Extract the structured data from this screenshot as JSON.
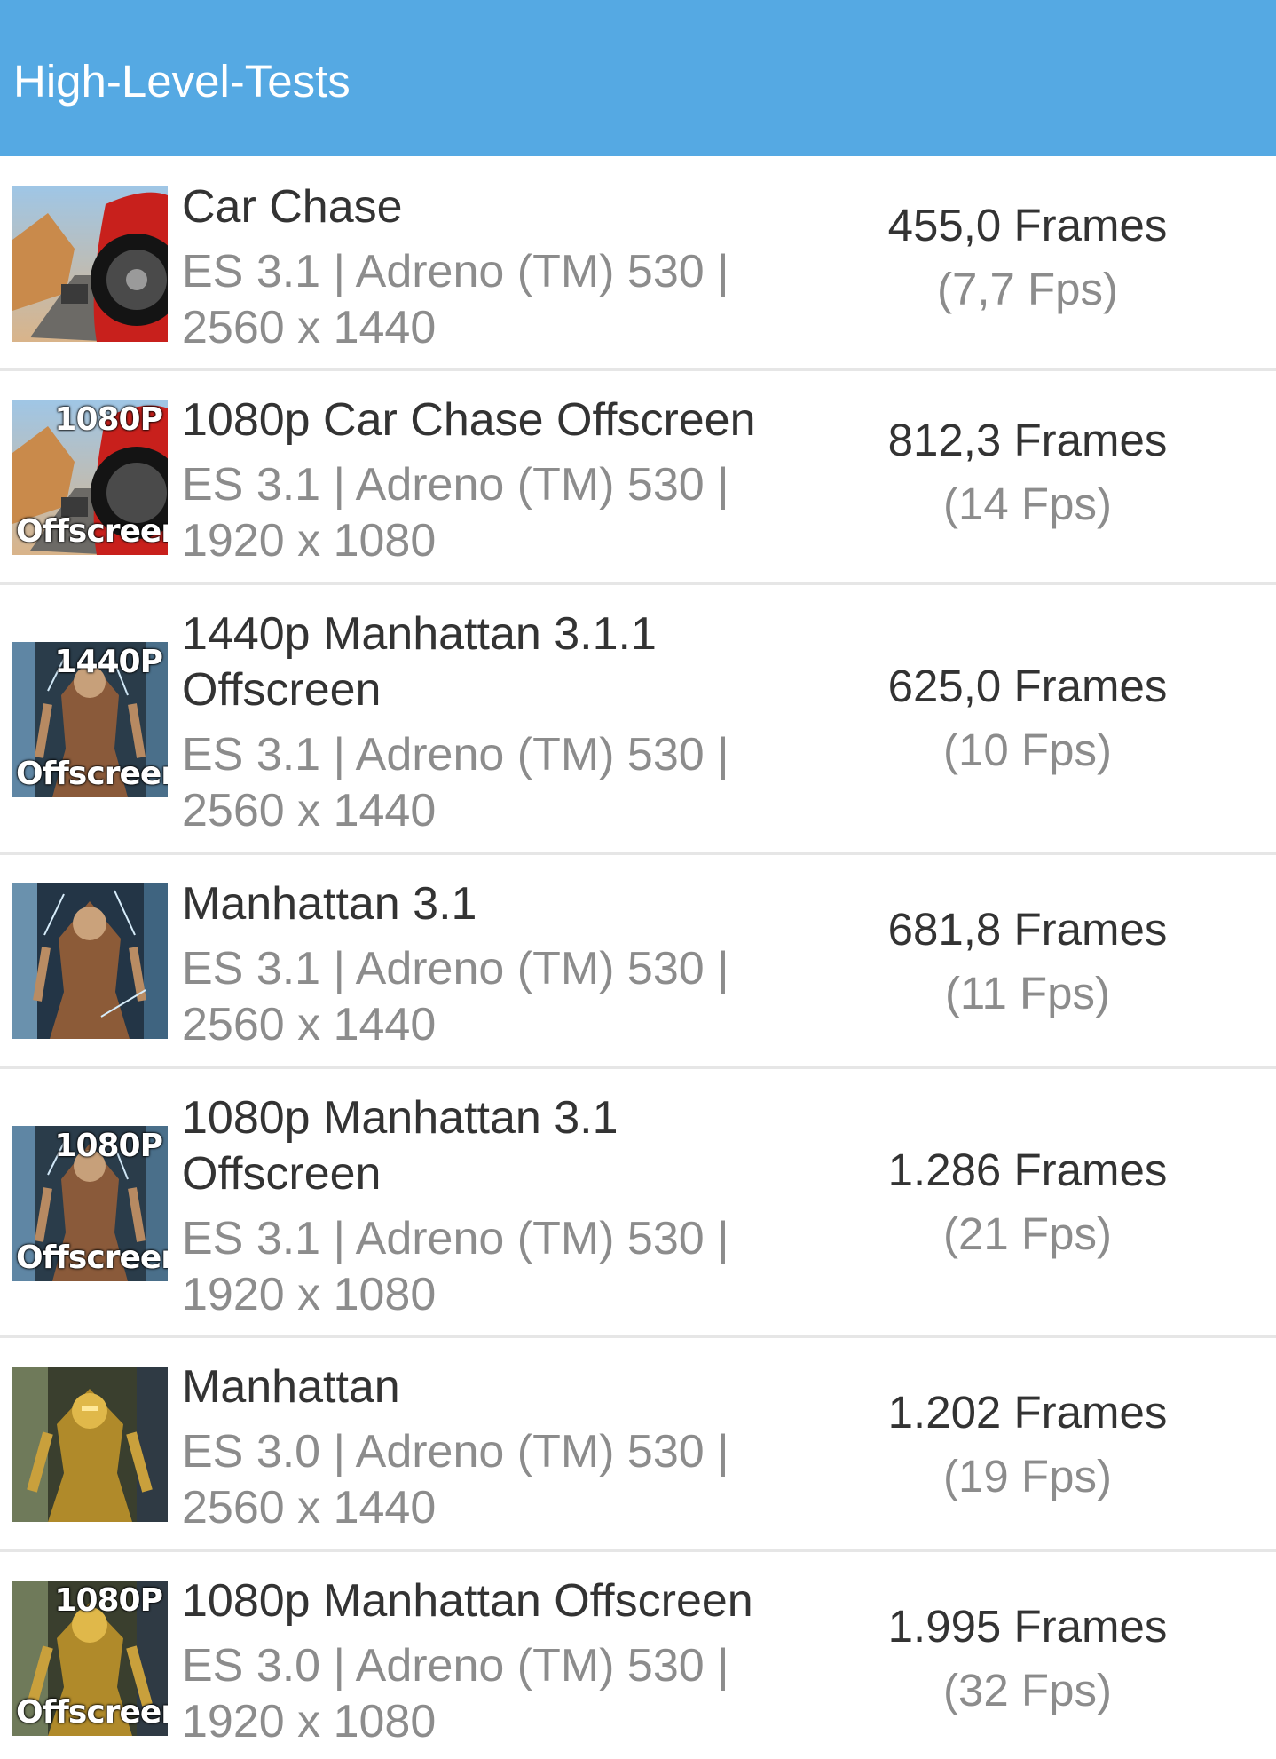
{
  "header": {
    "title": "High-Level-Tests",
    "color": "#55a9e3"
  },
  "tests": [
    {
      "name": "Car Chase",
      "api": "ES 3.1 | Adreno (TM) 530 |",
      "resolution": "2560 x 1440",
      "frames": "455,0 Frames",
      "fps": "(7,7 Fps)",
      "thumb_top": "",
      "thumb_bottom": "",
      "thumb_icon": "car-chase-thumbnail-icon"
    },
    {
      "name": "1080p Car Chase Offscreen",
      "api": "ES 3.1 | Adreno (TM) 530 |",
      "resolution": "1920 x 1080",
      "frames": "812,3 Frames",
      "fps": "(14 Fps)",
      "thumb_top": "1080P",
      "thumb_bottom": "Offscreen",
      "thumb_icon": "car-chase-offscreen-thumbnail-icon"
    },
    {
      "name": "1440p Manhattan 3.1.1 Offscreen",
      "api": "ES 3.1 | Adreno (TM) 530 |",
      "resolution": "2560 x 1440",
      "frames": "625,0 Frames",
      "fps": "(10 Fps)",
      "thumb_top": "1440P",
      "thumb_bottom": "Offscreen",
      "thumb_icon": "manhattan-offscreen-thumbnail-icon"
    },
    {
      "name": "Manhattan 3.1",
      "api": "ES 3.1 | Adreno (TM) 530 |",
      "resolution": "2560 x 1440",
      "frames": "681,8 Frames",
      "fps": "(11 Fps)",
      "thumb_top": "",
      "thumb_bottom": "",
      "thumb_icon": "manhattan-thumbnail-icon"
    },
    {
      "name": "1080p Manhattan 3.1 Offscreen",
      "api": "ES 3.1 | Adreno (TM) 530 |",
      "resolution": "1920 x 1080",
      "frames": "1.286 Frames",
      "fps": "(21 Fps)",
      "thumb_top": "1080P",
      "thumb_bottom": "Offscreen",
      "thumb_icon": "manhattan-offscreen-thumbnail-icon"
    },
    {
      "name": "Manhattan",
      "api": "ES 3.0 | Adreno (TM) 530 |",
      "resolution": "2560 x 1440",
      "frames": "1.202 Frames",
      "fps": "(19 Fps)",
      "thumb_top": "",
      "thumb_bottom": "",
      "thumb_icon": "manhattan-robot-thumbnail-icon"
    },
    {
      "name": "1080p Manhattan Offscreen",
      "api": "ES 3.0 | Adreno (TM) 530 |",
      "resolution": "1920 x 1080",
      "frames": "1.995 Frames",
      "fps": "(32 Fps)",
      "thumb_top": "1080P",
      "thumb_bottom": "Offscreen",
      "thumb_icon": "manhattan-robot-offscreen-thumbnail-icon"
    }
  ]
}
